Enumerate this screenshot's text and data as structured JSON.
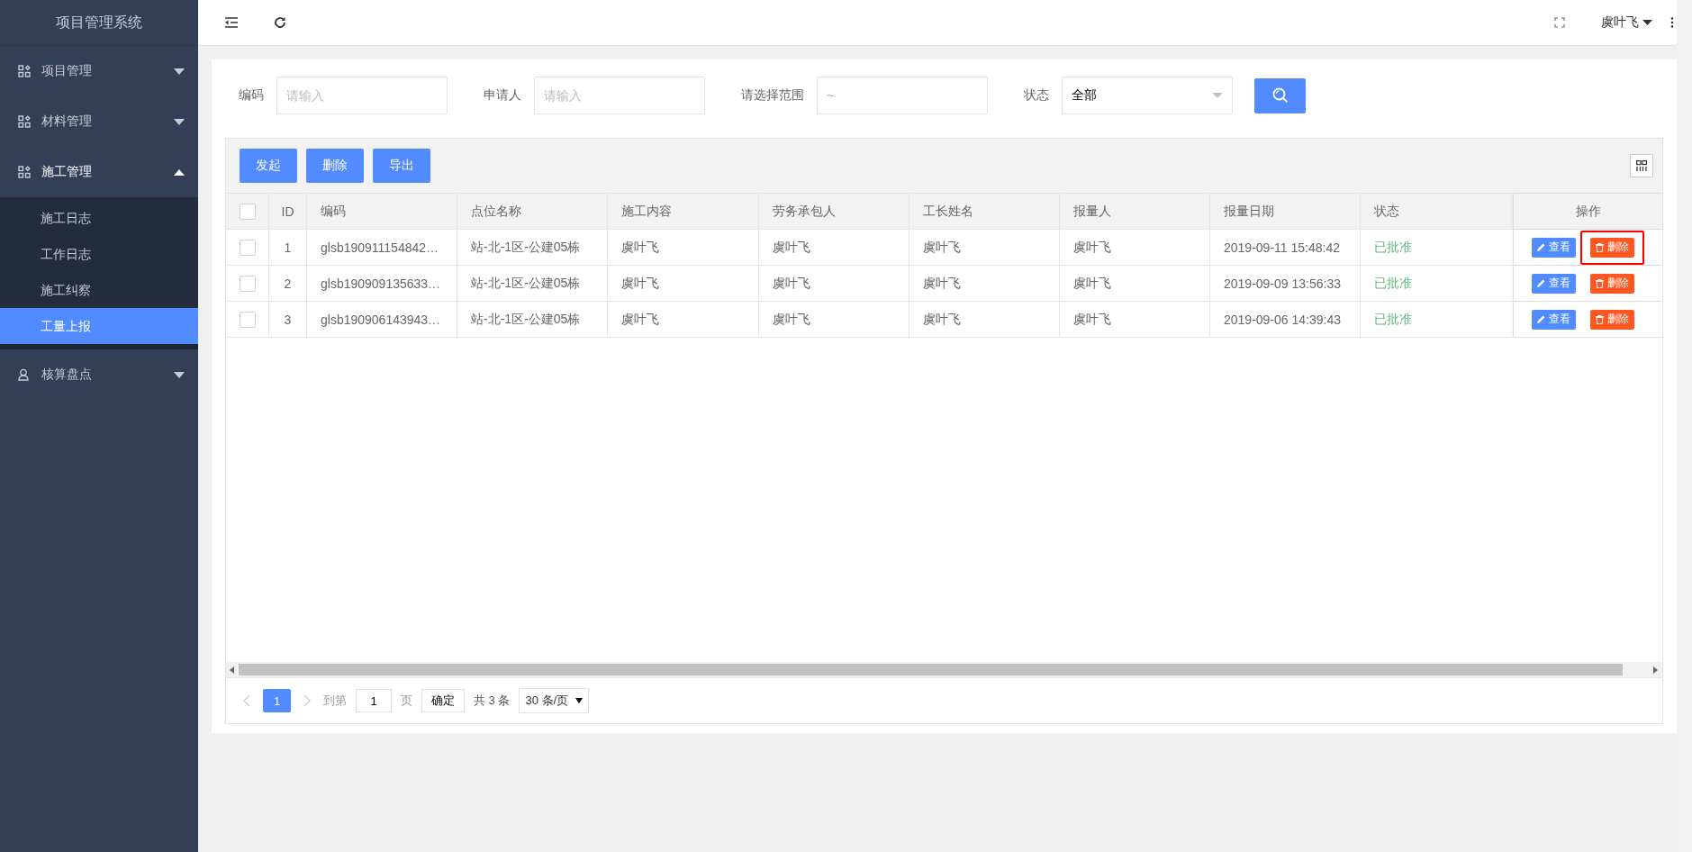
{
  "sidebar": {
    "title": "项目管理系统",
    "groups": [
      {
        "label": "项目管理",
        "expanded": false
      },
      {
        "label": "材料管理",
        "expanded": false
      },
      {
        "label": "施工管理",
        "expanded": true,
        "children": [
          {
            "label": "施工日志",
            "selected": false
          },
          {
            "label": "工作日志",
            "selected": false
          },
          {
            "label": "施工纠察",
            "selected": false
          },
          {
            "label": "工量上报",
            "selected": true
          }
        ]
      },
      {
        "label": "核算盘点",
        "expanded": false
      }
    ]
  },
  "topbar": {
    "user": "虞叶飞"
  },
  "filters": [
    {
      "kind": "input",
      "label": "编码",
      "placeholder": "请输入"
    },
    {
      "kind": "input",
      "label": "申请人",
      "placeholder": "请输入"
    },
    {
      "kind": "range",
      "label": "请选择范围",
      "placeholder": "~"
    },
    {
      "kind": "select",
      "label": "状态",
      "value": "全部"
    }
  ],
  "toolbar": {
    "buttons": [
      "发起",
      "删除",
      "导出"
    ]
  },
  "table": {
    "all_checked": false,
    "columns": [
      "ID",
      "编码",
      "点位名称",
      "施工内容",
      "劳务承包人",
      "工长姓名",
      "报量人",
      "报量日期",
      "状态",
      "操作"
    ],
    "rows": [
      {
        "checked": false,
        "cells": [
          "1",
          "glsb190911154842…",
          "站-北-1区-公建05栋",
          "虞叶飞",
          "虞叶飞",
          "虞叶飞",
          "虞叶飞",
          "2019-09-11 15:48:42",
          "已批准"
        ],
        "view": "查看",
        "delete": "删除",
        "delete_highlighted": true
      },
      {
        "checked": false,
        "cells": [
          "2",
          "glsb190909135633…",
          "站-北-1区-公建05栋",
          "虞叶飞",
          "虞叶飞",
          "虞叶飞",
          "虞叶飞",
          "2019-09-09 13:56:33",
          "已批准"
        ],
        "view": "查看",
        "delete": "删除",
        "delete_highlighted": false
      },
      {
        "checked": false,
        "cells": [
          "3",
          "glsb190906143943…",
          "站-北-1区-公建05栋",
          "虞叶飞",
          "虞叶飞",
          "虞叶飞",
          "虞叶飞",
          "2019-09-06 14:39:43",
          "已批准"
        ],
        "view": "查看",
        "delete": "删除",
        "delete_highlighted": false
      }
    ]
  },
  "pagination": {
    "pages": [
      {
        "label": "1",
        "selected": true
      }
    ],
    "goto_label": "到第",
    "goto_value": "1",
    "page_unit": "页",
    "confirm": "确定",
    "total": "共 3 条",
    "page_size": "30 条/页"
  }
}
